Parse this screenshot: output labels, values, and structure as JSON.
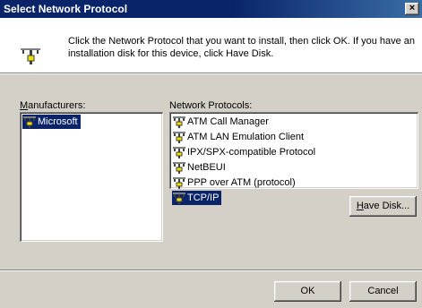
{
  "window": {
    "title": "Select Network Protocol",
    "close_glyph": "×"
  },
  "instruction": "Click the Network Protocol that you want to install, then click OK. If you have an installation disk for this device, click Have Disk.",
  "manufacturers": {
    "label_accel": "M",
    "label_rest": "anufacturers:",
    "items": [
      {
        "label": "Microsoft",
        "selected": true
      }
    ]
  },
  "protocols": {
    "label": "Network Protocols:",
    "items": [
      {
        "label": "ATM Call Manager",
        "selected": false
      },
      {
        "label": "ATM LAN Emulation Client",
        "selected": false
      },
      {
        "label": "IPX/SPX-compatible Protocol",
        "selected": false
      },
      {
        "label": "NetBEUI",
        "selected": false
      },
      {
        "label": "PPP over ATM (protocol)",
        "selected": false
      },
      {
        "label": "TCP/IP",
        "selected": true
      }
    ]
  },
  "buttons": {
    "have_disk_accel": "H",
    "have_disk_rest": "ave Disk...",
    "ok": "OK",
    "cancel": "Cancel"
  },
  "colors": {
    "selection": "#0a246a",
    "face": "#d4d0c8",
    "icon_yellow": "#f0e000"
  },
  "icons": {
    "header": "network-protocol-icon",
    "item": "network-cable-icon"
  }
}
